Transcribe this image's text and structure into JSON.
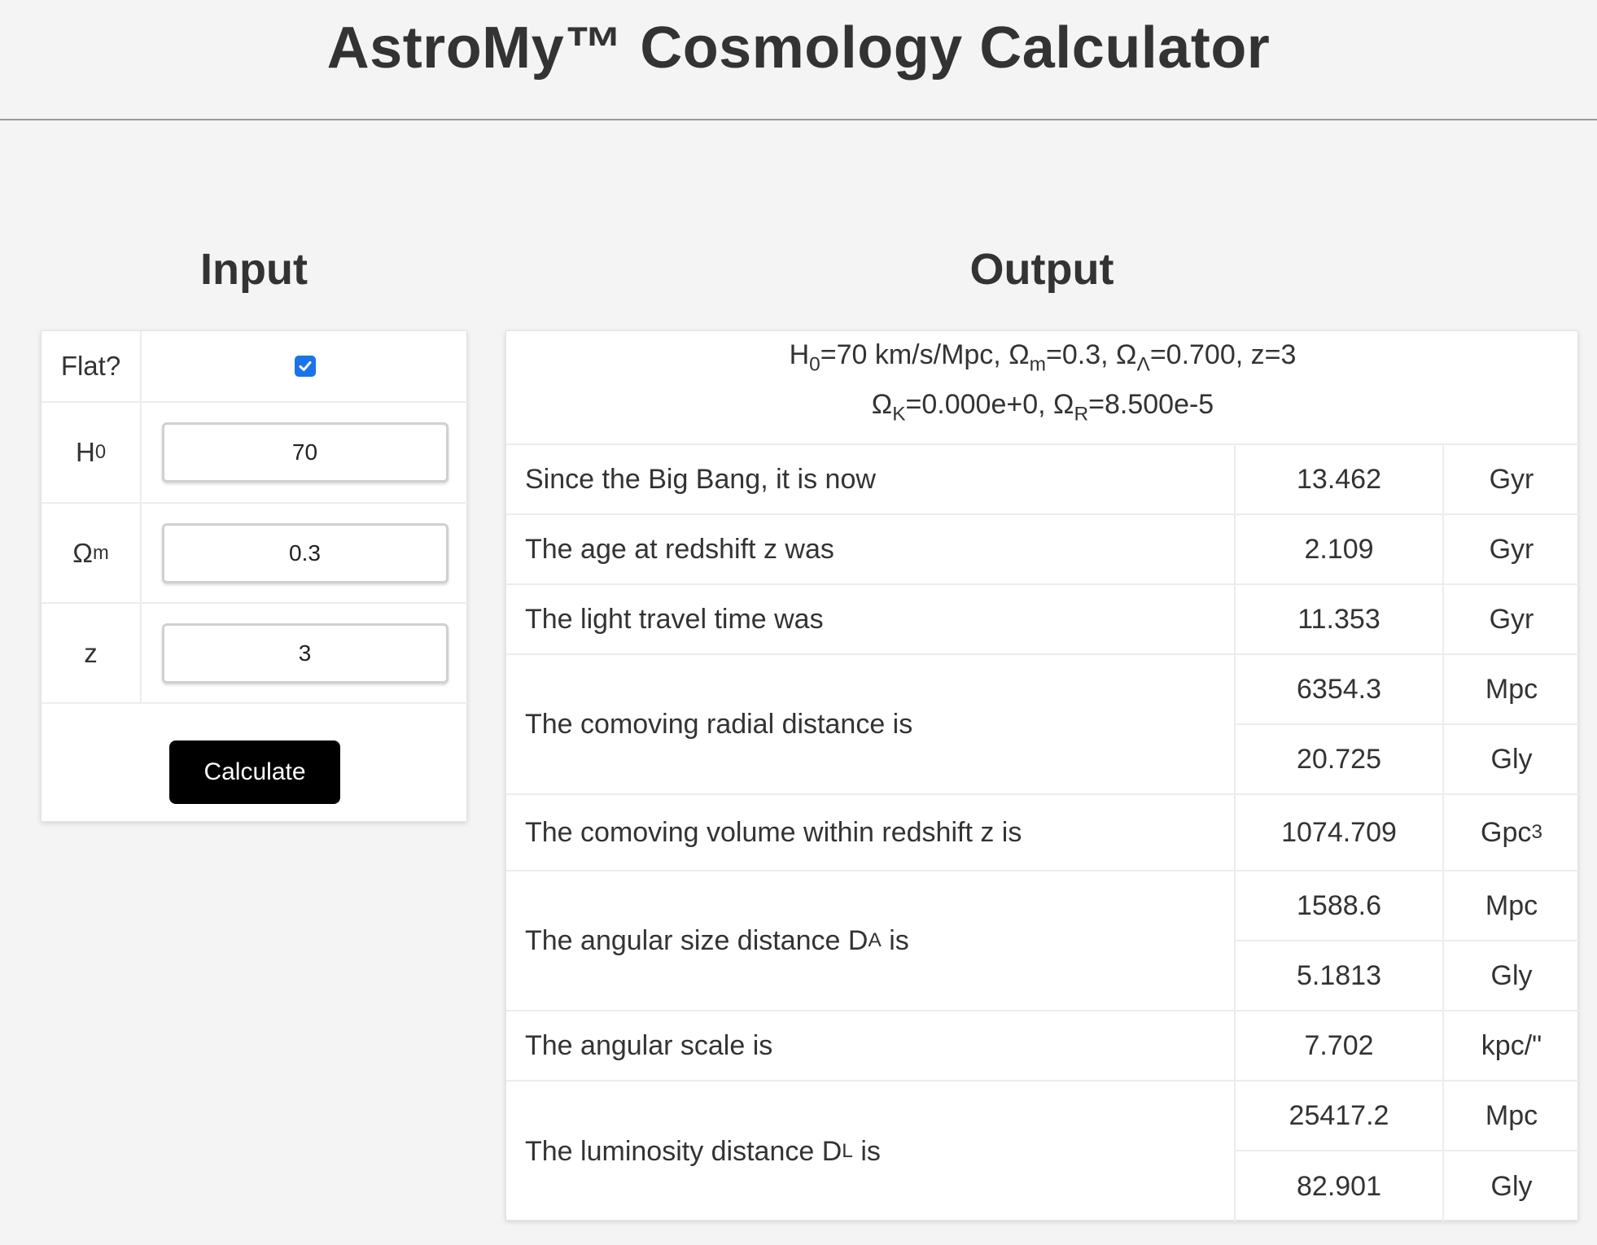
{
  "header": {
    "title": "AstroMy™ Cosmology Calculator"
  },
  "input": {
    "title": "Input",
    "flat_label": "Flat?",
    "flat_checked": true,
    "h0_label": "H",
    "h0_sub": "0",
    "h0_value": "70",
    "om_label": "Ω",
    "om_sub": "m",
    "om_value": "0.3",
    "z_label": "z",
    "z_value": "3",
    "calculate_label": "Calculate"
  },
  "output": {
    "title": "Output",
    "summary": {
      "line1": {
        "p1": "H",
        "s1": "0",
        "p2": "=70 km/s/Mpc, Ω",
        "s2": "m",
        "p3": "=0.3, Ω",
        "s3": "Λ",
        "p4": "=0.700, z=3"
      },
      "line2": {
        "p1": "Ω",
        "s1": "K",
        "p2": "=0.000e+0, Ω",
        "s2": "R",
        "p3": "=8.500e-5"
      }
    },
    "rows": {
      "age_now": {
        "label": "Since the Big Bang, it is now",
        "value": "13.462",
        "unit": "Gyr"
      },
      "age_z": {
        "label": "The age at redshift z was",
        "value": "2.109",
        "unit": "Gyr"
      },
      "light_travel": {
        "label": "The light travel time was",
        "value": "11.353",
        "unit": "Gyr"
      },
      "comoving_radial": {
        "label": "The comoving radial distance is",
        "value_mpc": "6354.3",
        "unit_mpc": "Mpc",
        "value_gly": "20.725",
        "unit_gly": "Gly"
      },
      "comoving_volume": {
        "label": "The comoving volume within redshift z is",
        "value": "1074.709",
        "unit": "Gpc",
        "unit_sup": "3"
      },
      "angular_size": {
        "label_pre": "The angular size distance D",
        "label_sub": "A",
        "label_post": " is",
        "value_mpc": "1588.6",
        "unit_mpc": "Mpc",
        "value_gly": "5.1813",
        "unit_gly": "Gly"
      },
      "angular_scale": {
        "label": "The angular scale is",
        "value": "7.702",
        "unit": "kpc/\""
      },
      "luminosity": {
        "label_pre": "The luminosity distance D",
        "label_sub": "L",
        "label_post": " is",
        "value_mpc": "25417.2",
        "unit_mpc": "Mpc",
        "value_gly": "82.901",
        "unit_gly": "Gly"
      }
    }
  },
  "colors": {
    "checkbox": "#1a73e8",
    "button": "#000000",
    "background": "#f4f4f4"
  }
}
